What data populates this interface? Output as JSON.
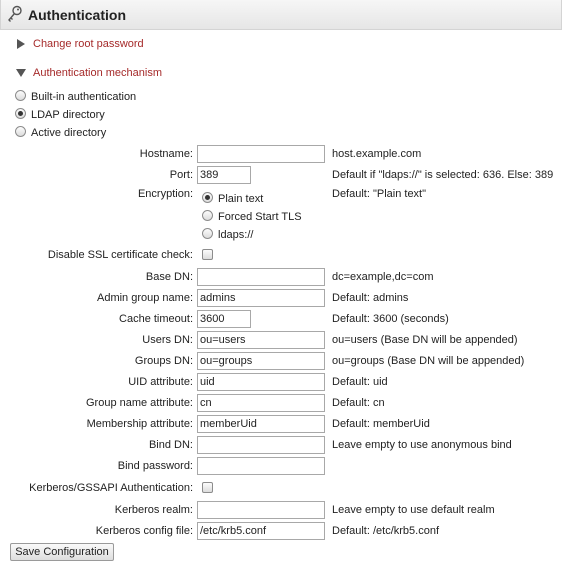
{
  "header": {
    "title": "Authentication",
    "icon": "key-icon"
  },
  "sections": {
    "root_password": {
      "label": "Change root password",
      "state": "collapsed"
    },
    "auth_mechanism": {
      "label": "Authentication mechanism",
      "state": "expanded"
    }
  },
  "mechanism": {
    "options": [
      "Built-in authentication",
      "LDAP directory",
      "Active directory"
    ],
    "selected": "LDAP directory"
  },
  "fields": {
    "hostname": {
      "label": "Hostname:",
      "value": "",
      "hint": "host.example.com"
    },
    "port": {
      "label": "Port:",
      "value": "389",
      "hint": "Default if \"ldaps://\" is selected: 636. Else: 389"
    },
    "encryption": {
      "label": "Encryption:",
      "options": [
        "Plain text",
        "Forced Start TLS",
        "ldaps://"
      ],
      "selected": "Plain text",
      "hint": "Default: \"Plain text\""
    },
    "ssl_check": {
      "label": "Disable SSL certificate check:",
      "checked": false
    },
    "base_dn": {
      "label": "Base DN:",
      "value": "",
      "hint": "dc=example,dc=com"
    },
    "admin_group": {
      "label": "Admin group name:",
      "value": "admins",
      "hint": "Default: admins"
    },
    "cache_timeout": {
      "label": "Cache timeout:",
      "value": "3600",
      "hint": "Default: 3600 (seconds)"
    },
    "users_dn": {
      "label": "Users DN:",
      "value": "ou=users",
      "hint": "ou=users (Base DN will be appended)"
    },
    "groups_dn": {
      "label": "Groups DN:",
      "value": "ou=groups",
      "hint": "ou=groups (Base DN will be appended)"
    },
    "uid_attr": {
      "label": "UID attribute:",
      "value": "uid",
      "hint": "Default: uid"
    },
    "group_name_attr": {
      "label": "Group name attribute:",
      "value": "cn",
      "hint": "Default: cn"
    },
    "membership_attr": {
      "label": "Membership attribute:",
      "value": "memberUid",
      "hint": "Default: memberUid"
    },
    "bind_dn": {
      "label": "Bind DN:",
      "value": "",
      "hint": "Leave empty to use anonymous bind"
    },
    "bind_password": {
      "label": "Bind password:",
      "value": ""
    },
    "kerberos_auth": {
      "label": "Kerberos/GSSAPI Authentication:",
      "checked": false
    },
    "kerberos_realm": {
      "label": "Kerberos realm:",
      "value": "",
      "hint": "Leave empty to use default realm"
    },
    "kerberos_config": {
      "label": "Kerberos config file:",
      "value": "/etc/krb5.conf",
      "hint": "Default: /etc/krb5.conf"
    }
  },
  "actions": {
    "save_label": "Save Configuration"
  }
}
